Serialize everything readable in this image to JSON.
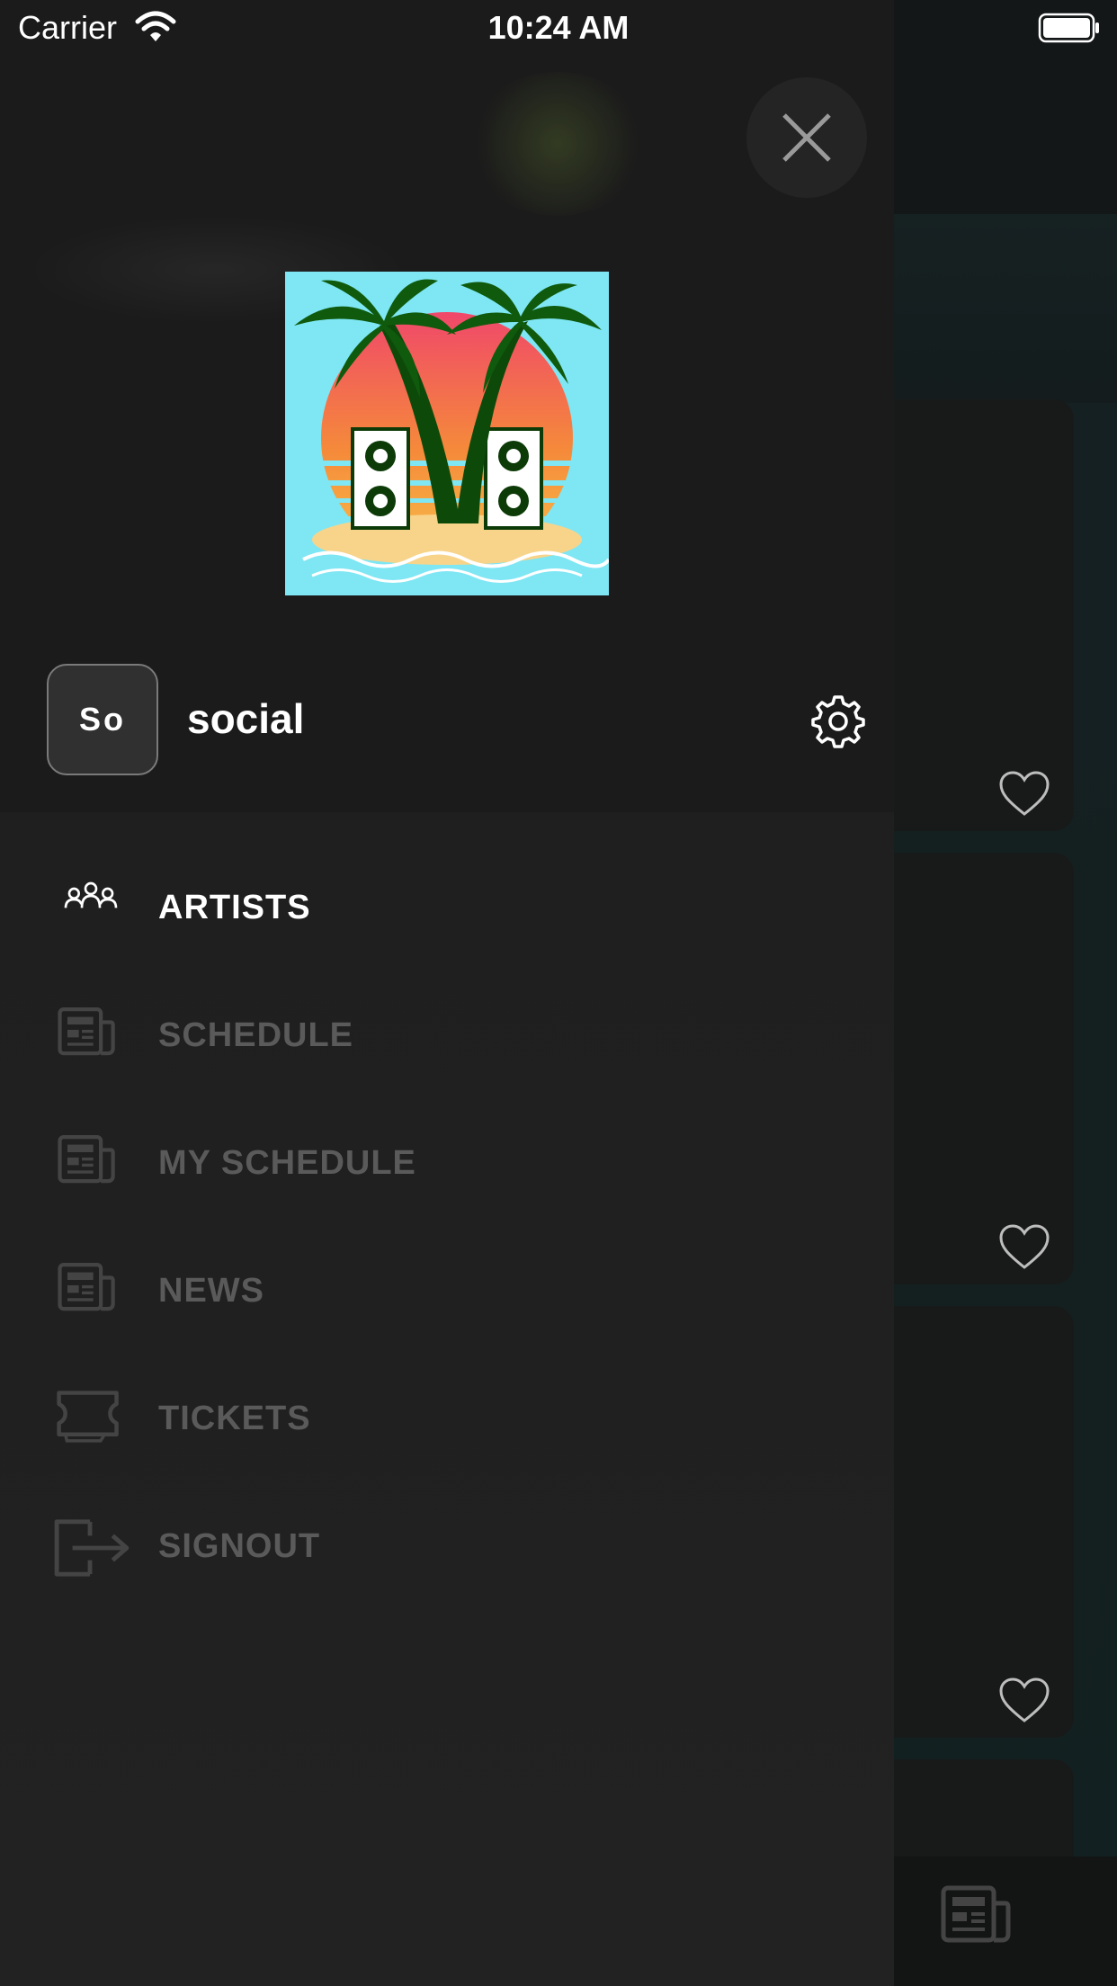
{
  "status_bar": {
    "carrier": "Carrier",
    "time": "10:24 AM"
  },
  "drawer": {
    "avatar_initials": "So",
    "username": "social",
    "menu": [
      {
        "label": "ARTISTS",
        "icon": "people-icon",
        "active": true
      },
      {
        "label": "SCHEDULE",
        "icon": "newspaper-icon",
        "active": false
      },
      {
        "label": "MY SCHEDULE",
        "icon": "newspaper-icon",
        "active": false
      },
      {
        "label": "NEWS",
        "icon": "newspaper-icon",
        "active": false
      },
      {
        "label": "TICKETS",
        "icon": "ticket-icon",
        "active": false
      },
      {
        "label": "SIGNOUT",
        "icon": "signout-icon",
        "active": false
      }
    ]
  },
  "colors": {
    "drawer_bg": "#1f1f1f",
    "active_text": "#ffffff",
    "inactive_text": "#5a5a5a",
    "logo_sky": "#7fe6f4"
  }
}
